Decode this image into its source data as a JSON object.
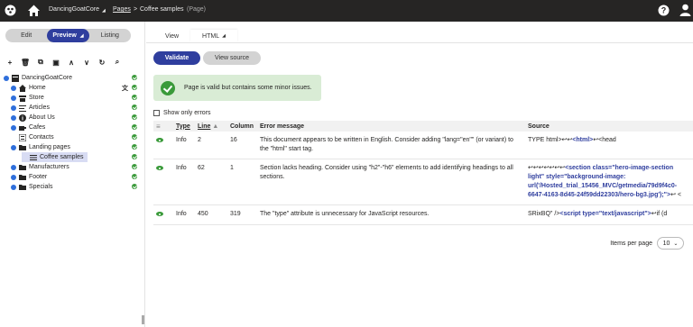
{
  "topbar": {
    "site": "DancingGoatCore",
    "crumb_link": "Pages",
    "crumb_page": "Coffee samples",
    "crumb_suffix": "(Page)"
  },
  "modes": {
    "edit": "Edit",
    "preview": "Preview",
    "listing": "Listing"
  },
  "toolbar": [
    "+",
    "🗑",
    "⧉",
    "▣",
    "∧",
    "∨",
    "↻",
    "⌕"
  ],
  "tree": [
    {
      "label": "DancingGoatCore",
      "icon": "site-icon",
      "level": 0,
      "exp": true
    },
    {
      "label": "Home",
      "icon": "home-icon",
      "level": 1,
      "exp": true
    },
    {
      "label": "Store",
      "icon": "store-icon",
      "level": 1,
      "exp": true
    },
    {
      "label": "Articles",
      "icon": "articles-icon",
      "level": 1,
      "exp": true
    },
    {
      "label": "About Us",
      "icon": "info-icon",
      "level": 1,
      "exp": true
    },
    {
      "label": "Cafes",
      "icon": "cup-icon",
      "level": 1,
      "exp": true
    },
    {
      "label": "Contacts",
      "icon": "contacts-icon",
      "level": 1,
      "exp": false
    },
    {
      "label": "Landing pages",
      "icon": "folder-icon",
      "level": 1,
      "exp": true
    },
    {
      "label": "Coffee samples",
      "icon": "page-icon",
      "level": 2,
      "exp": false,
      "selected": true
    },
    {
      "label": "Manufacturers",
      "icon": "folder-icon",
      "level": 1,
      "exp": true
    },
    {
      "label": "Footer",
      "icon": "folder-icon",
      "level": 1,
      "exp": true
    },
    {
      "label": "Specials",
      "icon": "folder-icon",
      "level": 1,
      "exp": true
    }
  ],
  "tabs": {
    "view": "View",
    "html": "HTML"
  },
  "buttons": {
    "validate": "Validate",
    "view_source": "View source"
  },
  "alert": "Page is valid but contains some minor issues.",
  "filter": "Show only errors",
  "table": {
    "headers": {
      "type": "Type",
      "line": "Line",
      "column": "Column",
      "error": "Error message",
      "source": "Source"
    },
    "rows": [
      {
        "type": "Info",
        "line": "2",
        "column": "16",
        "error": "This document appears to be written in English. Consider adding \"lang=\"en\"\" (or variant) to the \"html\" start tag.",
        "source_pre": "TYPE html>↩↩",
        "source_tag": "<html>",
        "source_post": "↩<head"
      },
      {
        "type": "Info",
        "line": "62",
        "column": "1",
        "error": "Section lacks heading. Consider using \"h2\"-\"h6\" elements to add identifying headings to all sections.",
        "source_pre": "↩↩↩↩↩↩↩",
        "source_tag": "<section class=\"hero-image-section light\" style=\"background-image: url('/Hosted_trial_15456_MVC/getmedia/79d9f4c0-6647-4163-8d45-24f59dd22303/hero-bg3.jpg');\">",
        "source_post": "↩ <"
      },
      {
        "type": "Info",
        "line": "450",
        "column": "319",
        "error": "The \"type\" attribute is unnecessary for JavaScript resources.",
        "source_pre": "SRixBQ\" />",
        "source_tag": "<script type=\"text/javascript\">",
        "source_post": "↩if (d"
      }
    ]
  },
  "pager": {
    "label": "Items per page",
    "value": "10"
  }
}
